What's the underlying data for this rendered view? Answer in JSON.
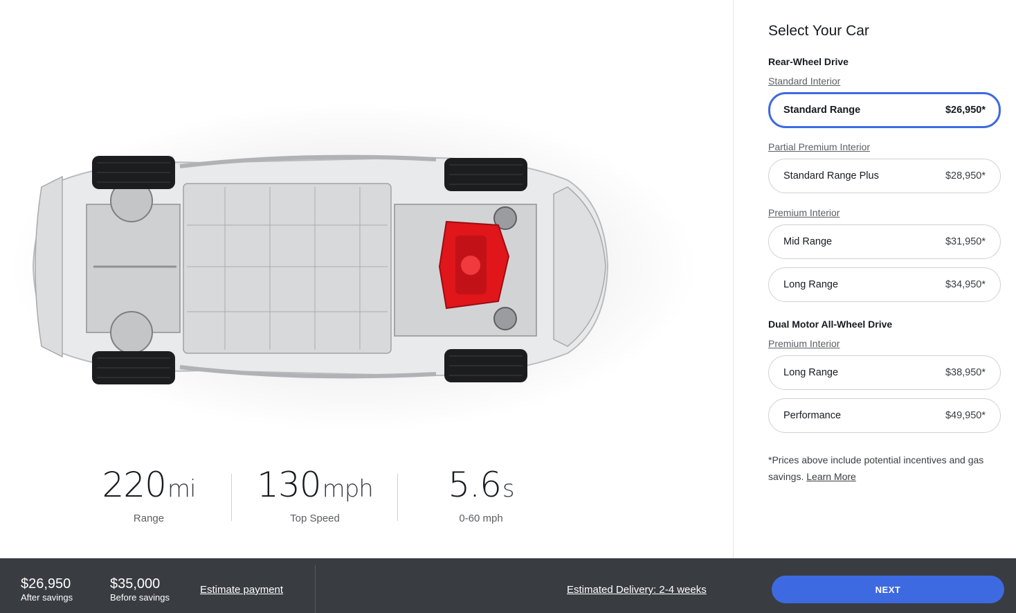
{
  "specs": [
    {
      "value": "220",
      "unit": "mi",
      "label": "Range"
    },
    {
      "value": "130",
      "unit": "mph",
      "label": "Top Speed"
    },
    {
      "value": "5.6",
      "unit": "s",
      "label": "0-60 mph"
    }
  ],
  "panel": {
    "title": "Select Your Car",
    "groups": [
      {
        "title": "Rear-Wheel Drive",
        "sections": [
          {
            "interior": "Standard Interior",
            "options": [
              {
                "name": "Standard Range",
                "price": "$26,950*",
                "selected": true
              }
            ]
          },
          {
            "interior": "Partial Premium Interior",
            "options": [
              {
                "name": "Standard Range Plus",
                "price": "$28,950*"
              }
            ]
          },
          {
            "interior": "Premium Interior",
            "options": [
              {
                "name": "Mid Range",
                "price": "$31,950*"
              },
              {
                "name": "Long Range",
                "price": "$34,950*"
              }
            ]
          }
        ]
      },
      {
        "title": "Dual Motor All-Wheel Drive",
        "sections": [
          {
            "interior": "Premium Interior",
            "options": [
              {
                "name": "Long Range",
                "price": "$38,950*"
              },
              {
                "name": "Performance",
                "price": "$49,950*"
              }
            ]
          }
        ]
      }
    ],
    "note_text": "*Prices above include potential incentives and gas savings.",
    "note_link": "Learn More"
  },
  "bar": {
    "after_savings_price": "$26,950",
    "after_savings_label": "After savings",
    "before_savings_price": "$35,000",
    "before_savings_label": "Before savings",
    "estimate_link": "Estimate payment",
    "delivery_link": "Estimated Delivery: 2-4 weeks",
    "next_label": "NEXT"
  },
  "colors": {
    "accent": "#3e6ae1",
    "bar_bg": "#393c41",
    "motor_red": "#e0161b"
  }
}
